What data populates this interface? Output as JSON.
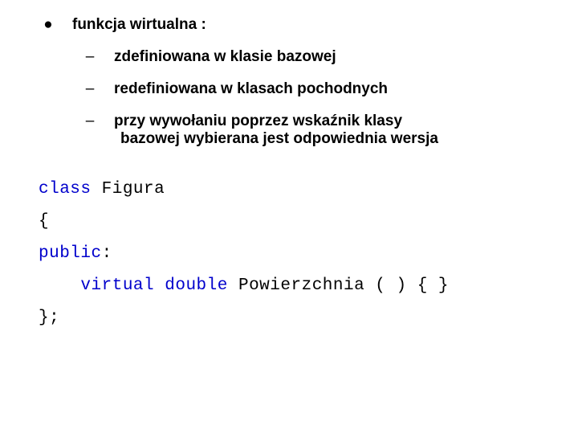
{
  "bullets": {
    "main": "funkcja wirtualna :",
    "sub1": "zdefiniowana w klasie bazowej",
    "sub2": "redefiniowana w klasach pochodnych",
    "sub3_l1": "przy wywołaniu poprzez wskaźnik klasy",
    "sub3_l2": "bazowej wybierana jest odpowiednia wersja"
  },
  "code": {
    "kw_class": "class",
    "name_figura": " Figura",
    "brace_open": "{",
    "kw_public": "public",
    "colon": ":",
    "indent": "    ",
    "kw_virtual": "virtual",
    "sp": " ",
    "kw_double": "double",
    "name_pow": " Powierzchnia ( ) { }",
    "brace_close": "};"
  },
  "glyph": {
    "dot": "●",
    "dash": "–"
  }
}
